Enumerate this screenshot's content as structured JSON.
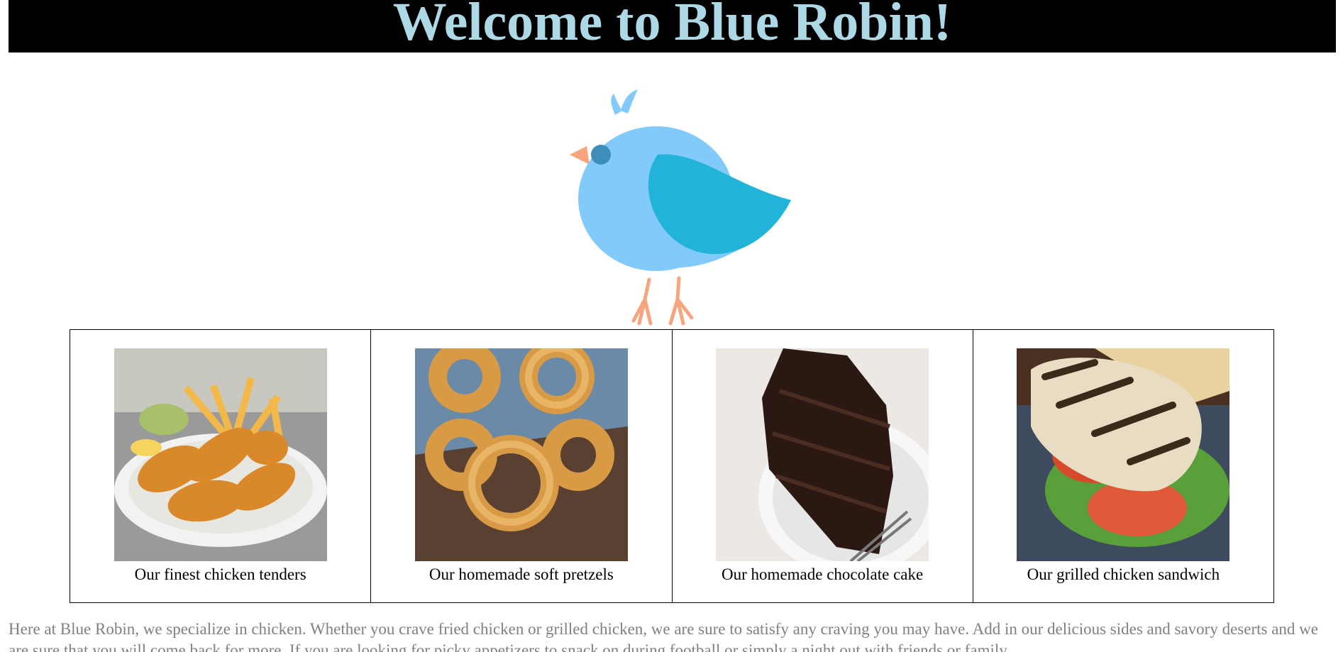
{
  "header": {
    "title": "Welcome to Blue Robin!",
    "background_color": "#000000",
    "title_color": "#add8e6"
  },
  "logo": {
    "icon": "blue-robin-bird-icon",
    "body_color": "#82cafc",
    "wing_color": "#22b4d8",
    "beak_color": "#f7a57d"
  },
  "menu": {
    "items": [
      {
        "caption": "Our finest chicken tenders",
        "image": "chicken-tenders-photo"
      },
      {
        "caption": "Our homemade soft pretzels",
        "image": "soft-pretzels-photo"
      },
      {
        "caption": "Our homemade chocolate cake",
        "image": "chocolate-cake-photo"
      },
      {
        "caption": "Our grilled chicken sandwich",
        "image": "grilled-chicken-sandwich-photo"
      }
    ]
  },
  "intro": {
    "text": "Here at Blue Robin, we specialize in chicken. Whether you crave fried chicken or grilled chicken, we are sure to satisfy any craving you may have. Add in our delicious sides and savory deserts and we are sure that you will come back for more. If you are looking for picky appetizers to snack on during football or simply a night out with friends or family"
  }
}
